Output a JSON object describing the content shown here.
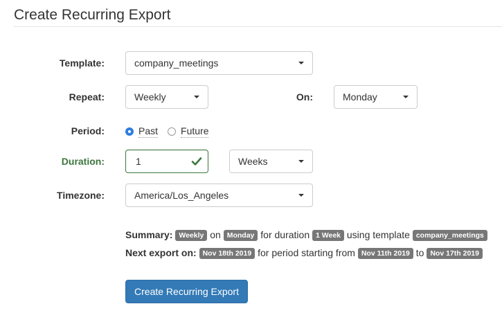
{
  "page_title": "Create Recurring Export",
  "form": {
    "template": {
      "label": "Template:",
      "value": "company_meetings"
    },
    "repeat": {
      "label": "Repeat:",
      "value": "Weekly"
    },
    "on": {
      "label": "On:",
      "value": "Monday"
    },
    "period": {
      "label": "Period:",
      "options": [
        {
          "label": "Past",
          "checked": true
        },
        {
          "label": "Future",
          "checked": false
        }
      ]
    },
    "duration": {
      "label": "Duration:",
      "value": "1",
      "unit": "Weeks"
    },
    "timezone": {
      "label": "Timezone:",
      "value": "America/Los_Angeles"
    }
  },
  "summary": {
    "label": "Summary:",
    "repeat_badge": "Weekly",
    "on_text": "on",
    "day_badge": "Monday",
    "duration_text": "for duration",
    "duration_badge": "1 Week",
    "template_text": "using template",
    "template_badge": "company_meetings"
  },
  "next_export": {
    "label": "Next export on:",
    "date_badge": "Nov 18th 2019",
    "period_text": "for period starting from",
    "start_badge": "Nov 11th 2019",
    "to_text": "to",
    "end_badge": "Nov 17th 2019"
  },
  "submit_label": "Create Recurring Export",
  "colors": {
    "primary": "#337ab7",
    "success": "#3c763d",
    "badge": "#777777"
  },
  "icons": {
    "validated": "check-icon",
    "dropdown": "caret-down-icon"
  }
}
